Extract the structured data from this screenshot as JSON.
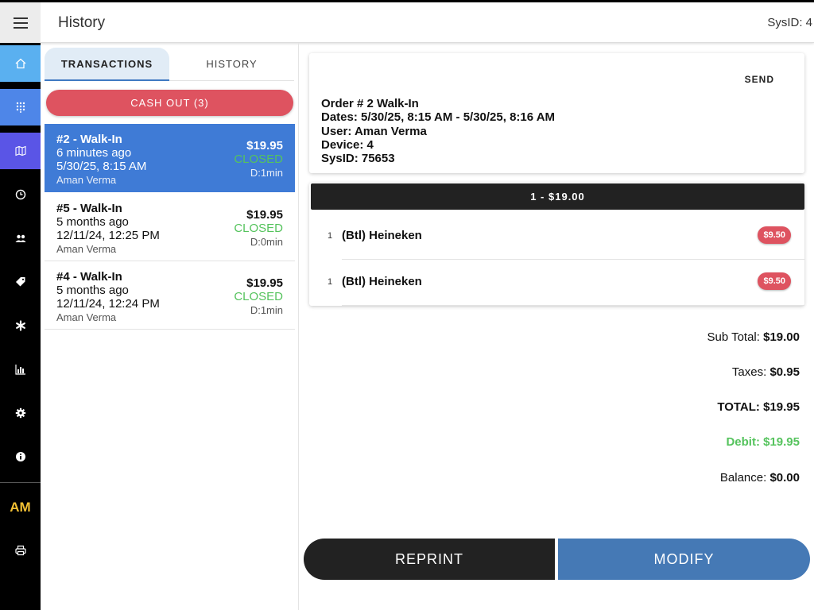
{
  "header": {
    "title": "History",
    "sysid": "SysID: 4",
    "menu_icon": "hamburger-menu-icon"
  },
  "sidebar": {
    "items": [
      {
        "icon": "home-icon",
        "color": "#5ab0f0"
      },
      {
        "icon": "keypad-icon",
        "color": "#4e86e8"
      },
      {
        "icon": "map-icon",
        "color": "#5a55e6"
      },
      {
        "icon": "clock-icon",
        "color": "#000000"
      },
      {
        "icon": "users-icon",
        "color": "#000000"
      },
      {
        "icon": "tags-icon",
        "color": "#000000"
      },
      {
        "icon": "asterisk-icon",
        "color": "#000000"
      },
      {
        "icon": "bar-chart-icon",
        "color": "#000000"
      },
      {
        "icon": "gear-icon",
        "color": "#000000"
      },
      {
        "icon": "info-icon",
        "color": "#000000"
      }
    ],
    "initials": "AM",
    "printer_icon": "printer-icon"
  },
  "tabs": {
    "transactions": "TRANSACTIONS",
    "history": "HISTORY"
  },
  "cashout": {
    "label": "CASH OUT (3)"
  },
  "transactions": [
    {
      "title": "#2 - Walk-In",
      "ago": "6 minutes ago",
      "date": "5/30/25, 8:15 AM",
      "user": "Aman Verma",
      "amount": "$19.95",
      "status": "CLOSED",
      "duration": "D:1min"
    },
    {
      "title": "#5 - Walk-In",
      "ago": "5 months ago",
      "date": "12/11/24, 12:25 PM",
      "user": "Aman Verma",
      "amount": "$19.95",
      "status": "CLOSED",
      "duration": "D:0min"
    },
    {
      "title": "#4 - Walk-In",
      "ago": "5 months ago",
      "date": "12/11/24, 12:24 PM",
      "user": "Aman Verma",
      "amount": "$19.95",
      "status": "CLOSED",
      "duration": "D:1min"
    }
  ],
  "order": {
    "send": "SEND",
    "lines": [
      "Order # 2 Walk-In",
      "Dates: 5/30/25, 8:15 AM - 5/30/25, 8:16 AM",
      "User: Aman Verma",
      "Device: 4",
      "SysID: 75653"
    ],
    "seat": "1 - $19.00",
    "items": [
      {
        "qty": "1",
        "name": "(Btl) Heineken",
        "price": "$9.50"
      },
      {
        "qty": "1",
        "name": "(Btl) Heineken",
        "price": "$9.50"
      }
    ]
  },
  "totals": {
    "subtotal_label": "Sub Total:",
    "subtotal": "$19.00",
    "taxes_label": "Taxes:",
    "taxes": "$0.95",
    "total_label": "TOTAL:",
    "total": "$19.95",
    "debit": "Debit: $19.95",
    "balance_label": "Balance:",
    "balance": "$0.00"
  },
  "actions": {
    "reprint": "REPRINT",
    "modify": "MODIFY"
  },
  "colors": {
    "accent": "#3f7bd6",
    "danger": "#de5360",
    "success": "#55c35d",
    "modify": "#4579b5"
  }
}
